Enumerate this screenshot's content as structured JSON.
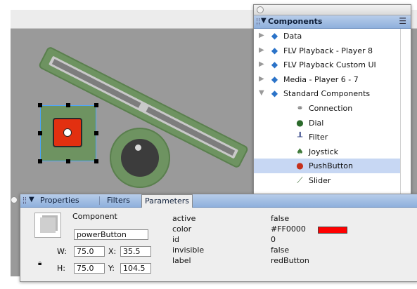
{
  "stage": {
    "background_color": "#9a9a9a",
    "graphic_color": "#6e9361",
    "button_color": "#e23010"
  },
  "components_panel": {
    "title": "Components",
    "items": [
      {
        "label": "Data",
        "type": "folder",
        "expanded": false,
        "icon": "package-icon"
      },
      {
        "label": "FLV Playback - Player 8",
        "type": "folder",
        "expanded": false,
        "icon": "package-icon"
      },
      {
        "label": "FLV Playback Custom UI",
        "type": "folder",
        "expanded": false,
        "icon": "package-icon"
      },
      {
        "label": "Media - Player 6 - 7",
        "type": "folder",
        "expanded": false,
        "icon": "package-icon"
      },
      {
        "label": "Standard Components",
        "type": "folder",
        "expanded": true,
        "icon": "package-icon"
      },
      {
        "label": "Connection",
        "type": "component",
        "icon": "connection-icon"
      },
      {
        "label": "Dial",
        "type": "component",
        "icon": "dial-icon"
      },
      {
        "label": "Filter",
        "type": "component",
        "icon": "filter-icon"
      },
      {
        "label": "Joystick",
        "type": "component",
        "icon": "joystick-icon"
      },
      {
        "label": "PushButton",
        "type": "component",
        "icon": "pushbutton-icon",
        "selected": true
      },
      {
        "label": "Slider",
        "type": "component",
        "icon": "slider-icon"
      }
    ]
  },
  "properties_panel": {
    "tabs": [
      {
        "label": "Properties",
        "active": false
      },
      {
        "label": "Filters",
        "active": false
      },
      {
        "label": "Parameters",
        "active": true
      }
    ],
    "component_label": "Component",
    "instance_name": "powerButton",
    "w_label": "W:",
    "w_value": "75.0",
    "h_label": "H:",
    "h_value": "75.0",
    "x_label": "X:",
    "x_value": "35.5",
    "y_label": "Y:",
    "y_value": "104.5",
    "parameters": [
      {
        "name": "active",
        "value": "false"
      },
      {
        "name": "color",
        "value": "#FF0000"
      },
      {
        "name": "id",
        "value": "0"
      },
      {
        "name": "invisible",
        "value": "false"
      },
      {
        "name": "label",
        "value": "redButton"
      }
    ],
    "color_swatch": "#FF0000"
  }
}
